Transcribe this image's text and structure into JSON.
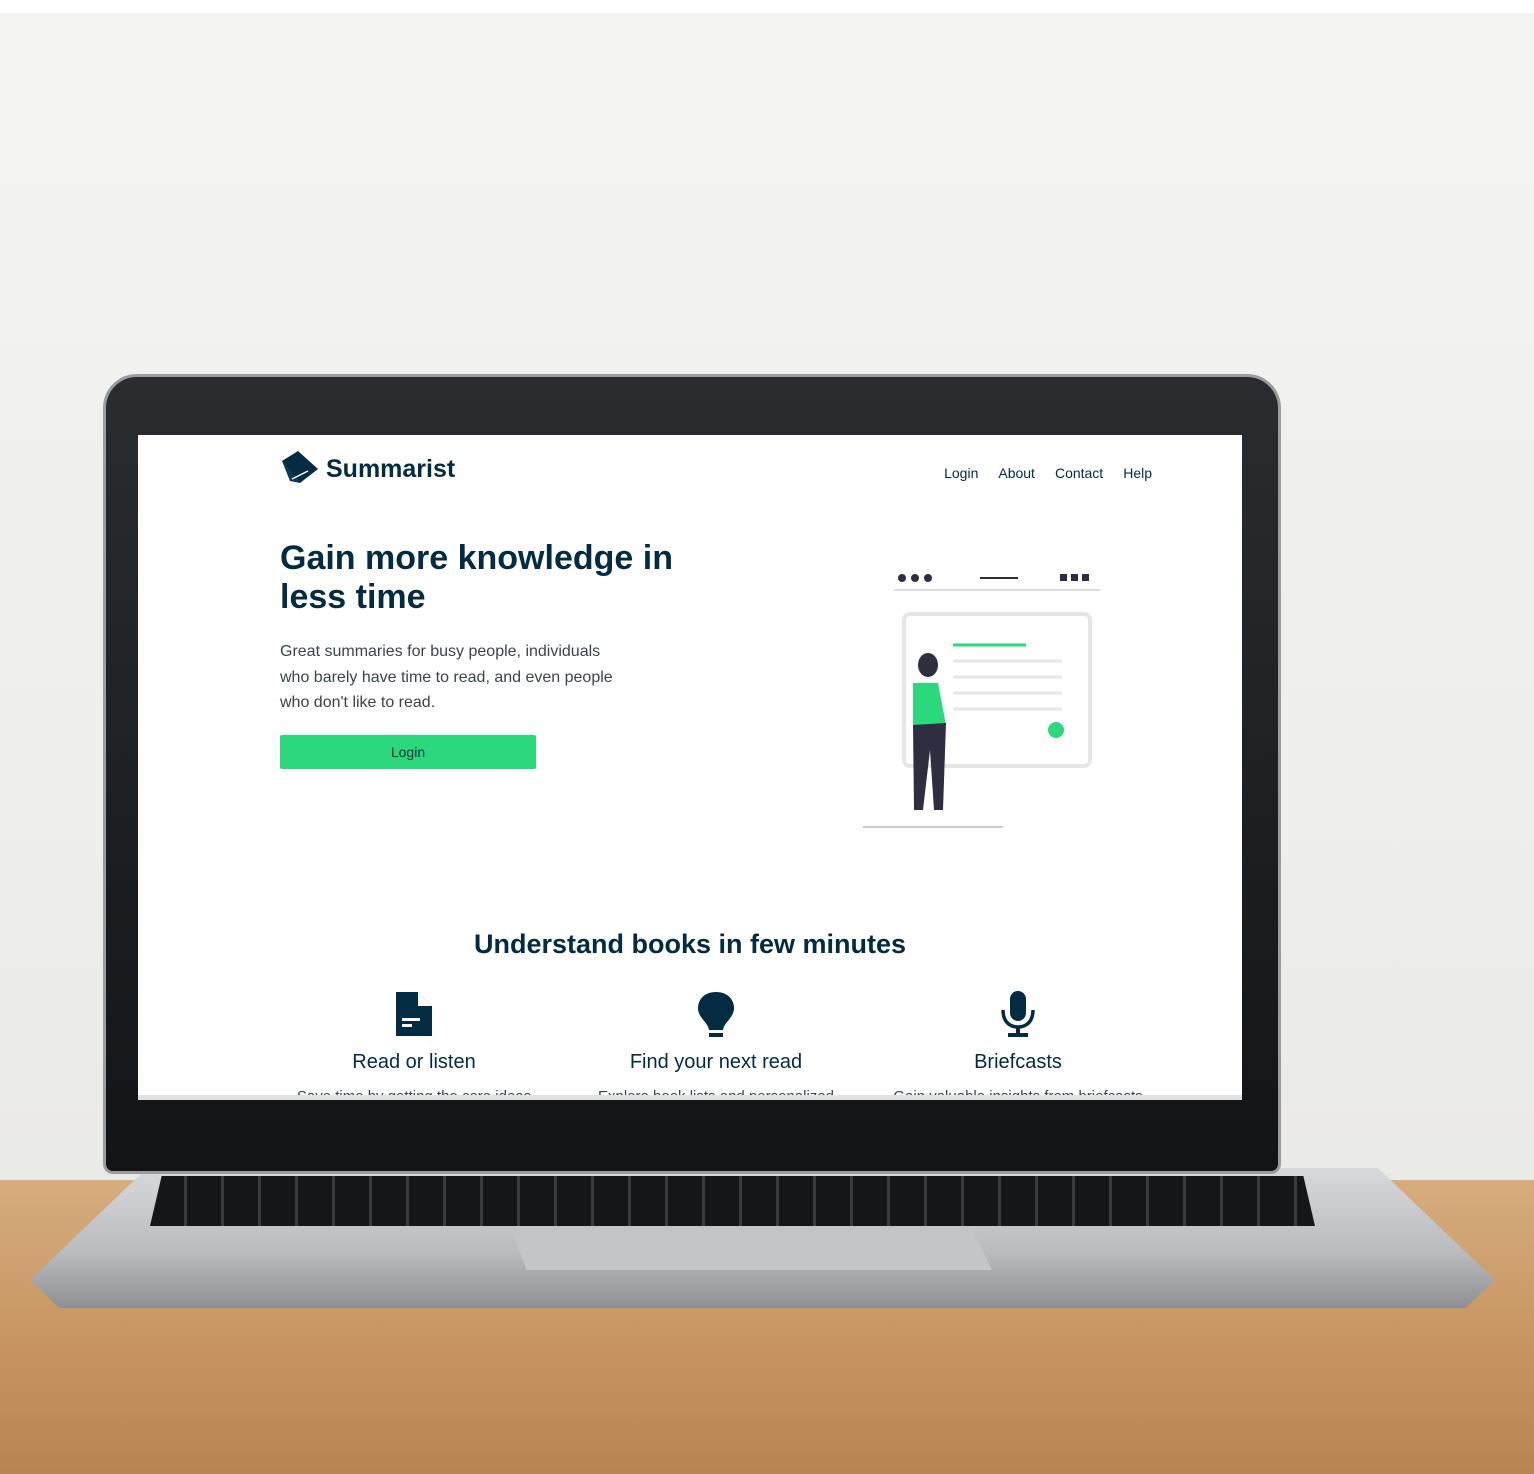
{
  "header": {
    "logo_text": "Summarist",
    "nav": [
      "Login",
      "About",
      "Contact",
      "Help"
    ]
  },
  "hero": {
    "title": "Gain more knowledge in less time",
    "subtitle": "Great summaries for busy people, individuals who barely have time to read, and even people who don't like to read.",
    "button_label": "Login"
  },
  "features": {
    "title": "Understand books in few minutes",
    "items": [
      {
        "icon": "document-icon",
        "title": "Read or listen",
        "desc": "Save time by getting the core ideas"
      },
      {
        "icon": "lightbulb-icon",
        "title": "Find your next read",
        "desc": "Explore book lists and personalized"
      },
      {
        "icon": "microphone-icon",
        "title": "Briefcasts",
        "desc": "Gain valuable insights from briefcasts"
      }
    ]
  },
  "colors": {
    "primary": "#032b41",
    "accent": "#2bd97c",
    "text": "#394547"
  }
}
